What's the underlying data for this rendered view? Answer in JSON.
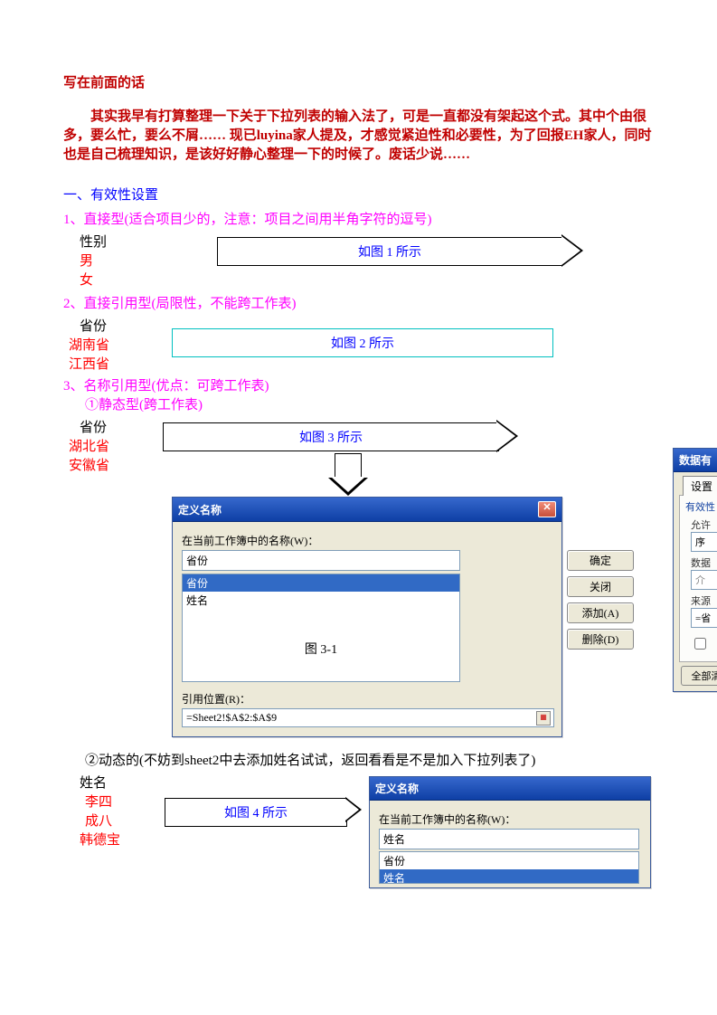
{
  "preface": {
    "title": "写在前面的话",
    "body": "其实我早有打算整理一下关于下拉列表的输入法了，可是一直都没有架起这个式。其中个由很多，要么忙，要么不屑…… 现已luyina家人提及，才感觉紧迫性和必要性，为了回报EH家人，同时也是自己梳理知识，是该好好静心整理一下的时候了。废话少说……"
  },
  "sec1": {
    "heading": "一、有效性设置",
    "item1": {
      "label": "1、直接型(适合项目少的，注意：项目之间用半角字符的逗号)",
      "field": "性别",
      "options": [
        "男",
        "女"
      ],
      "arrow": "如图 1 所示"
    },
    "item2": {
      "label": "2、直接引用型(局限性，不能跨工作表)",
      "field": "省份",
      "options": [
        "湖南省",
        "江西省"
      ],
      "arrow": "如图 2 所示"
    },
    "item3": {
      "label": "3、名称引用型(优点：可跨工作表)",
      "sub1": "①静态型(跨工作表)",
      "field": "省份",
      "options": [
        "湖北省",
        "安徽省"
      ],
      "arrow": "如图 3 所示"
    }
  },
  "dialog1": {
    "title": "定义名称",
    "listLabel": "在当前工作簿中的名称(W)：",
    "inputTop": "省份",
    "items": [
      "省份",
      "姓名"
    ],
    "refLabel": "引用位置(R)：",
    "refValue": "=Sheet2!$A$2:$A$9",
    "buttons": {
      "ok": "确定",
      "close": "关闭",
      "add": "添加(A)",
      "del": "删除(D)"
    },
    "figCaption": "图 3-1"
  },
  "sec3b": {
    "sub2": "②动态的(不妨到sheet2中去添加姓名试试，返回看看是不是加入下拉列表了)",
    "field": "姓名",
    "options": [
      "李四",
      "成八",
      "韩德宝"
    ],
    "arrow": "如图 4 所示"
  },
  "dialog2": {
    "title": "定义名称",
    "listLabel": "在当前工作簿中的名称(W)：",
    "inputTop": "姓名",
    "items": [
      "省份",
      "姓名"
    ]
  },
  "partialDialog": {
    "title": "数据有",
    "tab": "设置",
    "line1": "有效性",
    "allow": "允许",
    "allowVal": "序",
    "data": "数据",
    "dataVal": "介",
    "source": "来源",
    "sourceVal": "=省",
    "clearAll": "全部清"
  }
}
